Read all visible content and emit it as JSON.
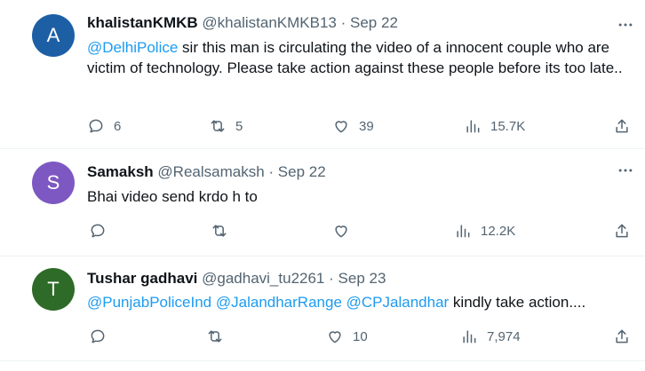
{
  "colors": {
    "accent": "#1d9bf0",
    "secondary_text": "#536471",
    "avatar_a": "#1d5fa5",
    "avatar_s": "#7e58c2",
    "avatar_t": "#2e6b28"
  },
  "tweets": [
    {
      "avatar_letter": "A",
      "name": "khalistanKMKB",
      "handle": "@khalistanKMKB13",
      "dot": "·",
      "date": "Sep 22",
      "mention1": "@DelhiPolice",
      "text": " sir this man is circulating the video of a innocent couple who are victim of technology. Please take action against these people before its too late..",
      "replies": "6",
      "retweets": "5",
      "likes": "39",
      "views": "15.7K"
    },
    {
      "avatar_letter": "S",
      "name": "Samaksh",
      "handle": "@Realsamaksh",
      "dot": "·",
      "date": "Sep 22",
      "text": "Bhai video send krdo h to",
      "views": "12.2K"
    },
    {
      "avatar_letter": "T",
      "name": "Tushar gadhavi",
      "handle": "@gadhavi_tu2261",
      "dot": "·",
      "date": "Sep 23",
      "mention1": "@PunjabPoliceInd",
      "mention2": "@JalandharRange",
      "mention3": "@CPJalandhar",
      "text": " kindly take action....",
      "likes": "10",
      "views": "7,974"
    }
  ]
}
